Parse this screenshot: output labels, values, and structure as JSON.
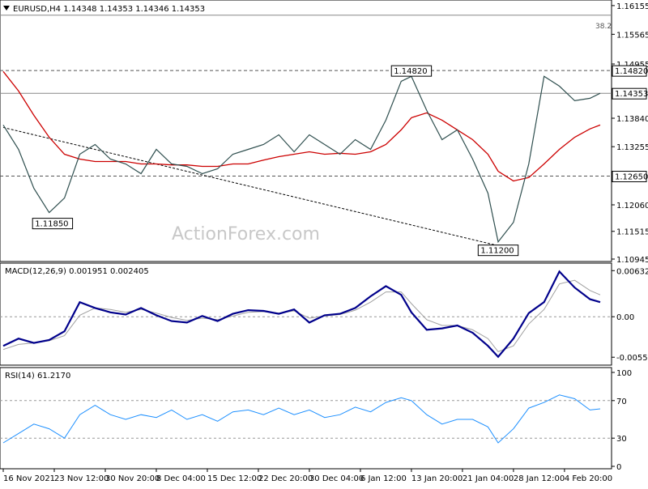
{
  "chart_data": {
    "type": "line",
    "title": "EURUSD,H4  1.14348 1.14353 1.14346 1.14353",
    "instrument": "EURUSD",
    "timeframe": "H4",
    "ohlc": [
      1.14348,
      1.14353,
      1.14346,
      1.14353
    ],
    "watermark": "ActionForex.com",
    "x_tick_labels": [
      "16 Nov 2021",
      "23 Nov 12:00",
      "30 Nov 20:00",
      "8 Dec 04:00",
      "15 Dec 12:00",
      "22 Dec 20:00",
      "30 Dec 04:00",
      "6 Jan 12:00",
      "13 Jan 20:00",
      "21 Jan 04:00",
      "28 Jan 12:00",
      "4 Feb 20:00"
    ],
    "x_tick_index": [
      0,
      10,
      20,
      30,
      40,
      50,
      60,
      70,
      80,
      90,
      100,
      110
    ],
    "bar_count": 118,
    "price_panel": {
      "ylim": [
        1.10945,
        1.1622
      ],
      "y_ticks": [
        "1.16155",
        "1.15565",
        "1.14955",
        "1.13840",
        "1.13255",
        "1.12060",
        "1.11515",
        "1.10945"
      ],
      "highlighted_labels": [
        {
          "text": "1.14820",
          "value": 1.1482
        },
        {
          "text": "1.14353",
          "value": 1.14353
        },
        {
          "text": "1.12650",
          "value": 1.1265
        }
      ],
      "fib_label": "38.2",
      "fib_level": 1.15958,
      "h_lines": [
        {
          "value": 1.1482,
          "style": "dashed"
        },
        {
          "value": 1.14353,
          "style": "solid"
        },
        {
          "value": 1.1265,
          "style": "dashed"
        },
        {
          "value": 1.15958,
          "style": "solid"
        }
      ],
      "annotations": [
        {
          "text": "1.14820",
          "index": 80,
          "value": 1.1482
        },
        {
          "text": "1.11850",
          "index": 12,
          "value": 1.1185
        },
        {
          "text": "1.11200",
          "index": 97,
          "value": 1.112
        }
      ],
      "trendline": {
        "start": [
          0,
          1.1365
        ],
        "end": [
          97,
          1.1122
        ]
      },
      "close_series": {
        "name": "EURUSD",
        "color": "#2f4f4f",
        "x": [
          0,
          3,
          6,
          9,
          12,
          15,
          18,
          21,
          24,
          27,
          30,
          33,
          36,
          39,
          42,
          45,
          48,
          51,
          54,
          57,
          60,
          63,
          66,
          69,
          72,
          75,
          78,
          80,
          83,
          86,
          89,
          92,
          95,
          97,
          100,
          103,
          106,
          109,
          112,
          115,
          117
        ],
        "values": [
          1.137,
          1.132,
          1.124,
          1.119,
          1.122,
          1.131,
          1.133,
          1.13,
          1.129,
          1.127,
          1.132,
          1.129,
          1.1285,
          1.127,
          1.128,
          1.131,
          1.132,
          1.133,
          1.135,
          1.1315,
          1.135,
          1.133,
          1.131,
          1.134,
          1.132,
          1.138,
          1.146,
          1.147,
          1.14,
          1.134,
          1.136,
          1.13,
          1.123,
          1.113,
          1.117,
          1.129,
          1.147,
          1.145,
          1.142,
          1.1425,
          1.14353
        ]
      },
      "ma_series": {
        "color": "#cc0000",
        "x": [
          0,
          3,
          6,
          9,
          12,
          15,
          18,
          21,
          24,
          27,
          30,
          33,
          36,
          39,
          42,
          45,
          48,
          51,
          54,
          57,
          60,
          63,
          66,
          69,
          72,
          75,
          78,
          80,
          83,
          86,
          89,
          92,
          95,
          97,
          100,
          103,
          106,
          109,
          112,
          115,
          117
        ],
        "values": [
          1.148,
          1.144,
          1.139,
          1.1345,
          1.131,
          1.13,
          1.1295,
          1.1295,
          1.1295,
          1.129,
          1.129,
          1.1288,
          1.1288,
          1.1285,
          1.1285,
          1.129,
          1.129,
          1.1298,
          1.1305,
          1.131,
          1.1315,
          1.131,
          1.1312,
          1.131,
          1.1315,
          1.133,
          1.136,
          1.1385,
          1.1395,
          1.138,
          1.136,
          1.134,
          1.131,
          1.1275,
          1.1255,
          1.1262,
          1.129,
          1.132,
          1.1345,
          1.1362,
          1.137
        ]
      }
    },
    "macd_panel": {
      "label": "MACD(12,26,9) 0.001951 0.002405",
      "ylim": [
        -0.0062,
        0.0068
      ],
      "y_ticks": [
        "0.006325",
        "0.00",
        "-0.005559"
      ],
      "zero_line": 0,
      "macd_series": {
        "color": "#00008b",
        "x": [
          0,
          3,
          6,
          9,
          12,
          15,
          18,
          21,
          24,
          27,
          30,
          33,
          36,
          39,
          42,
          45,
          48,
          51,
          54,
          57,
          60,
          63,
          66,
          69,
          72,
          75,
          78,
          80,
          83,
          86,
          89,
          92,
          95,
          97,
          100,
          103,
          106,
          109,
          112,
          115,
          117
        ],
        "values": [
          -0.004,
          -0.003,
          -0.0036,
          -0.0032,
          -0.002,
          0.002,
          0.0012,
          0.0006,
          0.0003,
          0.0012,
          0.0002,
          -0.0006,
          -0.0008,
          0.0001,
          -0.0006,
          0.0004,
          0.0009,
          0.0008,
          0.0004,
          0.001,
          -0.0008,
          0.0002,
          0.0004,
          0.0012,
          0.0028,
          0.0042,
          0.003,
          0.0006,
          -0.0018,
          -0.0016,
          -0.0012,
          -0.0022,
          -0.004,
          -0.0055,
          -0.003,
          0.0005,
          0.002,
          0.0062,
          0.004,
          0.0024,
          0.002
        ]
      },
      "signal_series": {
        "color": "#a0a0a0",
        "x": [
          0,
          3,
          6,
          9,
          12,
          15,
          18,
          21,
          24,
          27,
          30,
          33,
          36,
          39,
          42,
          45,
          48,
          51,
          54,
          57,
          60,
          63,
          66,
          69,
          72,
          75,
          78,
          80,
          83,
          86,
          89,
          92,
          95,
          97,
          100,
          103,
          106,
          109,
          112,
          115,
          117
        ],
        "values": [
          -0.0045,
          -0.0038,
          -0.0036,
          -0.0033,
          -0.0026,
          0.0002,
          0.0012,
          0.001,
          0.0006,
          0.001,
          0.0005,
          -0.0001,
          -0.0005,
          -0.0002,
          -0.0004,
          0.0001,
          0.0006,
          0.0007,
          0.0005,
          0.0008,
          -0.0002,
          0.0001,
          0.0003,
          0.0009,
          0.002,
          0.0034,
          0.0034,
          0.0018,
          -0.0004,
          -0.0012,
          -0.0012,
          -0.0018,
          -0.003,
          -0.0048,
          -0.004,
          -0.001,
          0.001,
          0.0045,
          0.005,
          0.0036,
          0.003
        ]
      }
    },
    "rsi_panel": {
      "label": "RSI(14) 61.2170",
      "ylim": [
        0,
        100
      ],
      "y_ticks": [
        "100",
        "70",
        "30",
        "0"
      ],
      "levels": [
        70,
        30
      ],
      "rsi_series": {
        "color": "#1e90ff",
        "x": [
          0,
          3,
          6,
          9,
          12,
          15,
          18,
          21,
          24,
          27,
          30,
          33,
          36,
          39,
          42,
          45,
          48,
          51,
          54,
          57,
          60,
          63,
          66,
          69,
          72,
          75,
          78,
          80,
          83,
          86,
          89,
          92,
          95,
          97,
          100,
          103,
          106,
          109,
          112,
          115,
          117
        ],
        "values": [
          25,
          35,
          45,
          40,
          30,
          55,
          65,
          55,
          50,
          55,
          52,
          60,
          50,
          55,
          48,
          58,
          60,
          55,
          62,
          55,
          60,
          52,
          55,
          63,
          58,
          68,
          73,
          70,
          55,
          45,
          50,
          50,
          42,
          25,
          40,
          62,
          68,
          76,
          72,
          60,
          61.217
        ]
      }
    }
  }
}
